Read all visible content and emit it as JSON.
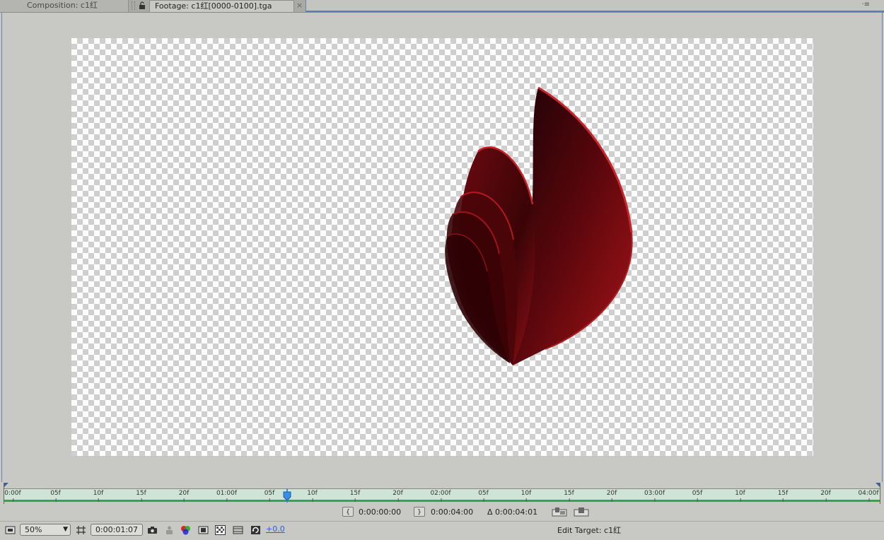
{
  "tabs": {
    "composition_label": "Composition: c1红",
    "footage_label": "Footage: c1红[0000-0100].tga",
    "dropdown_glyph": "▼",
    "close_glyph": "×",
    "panel_menu_glyph": "·≡"
  },
  "ruler": {
    "ticks": [
      {
        "label": "0:00f"
      },
      {
        "label": "05f"
      },
      {
        "label": "10f"
      },
      {
        "label": "15f"
      },
      {
        "label": "20f"
      },
      {
        "label": "01:00f"
      },
      {
        "label": "05f"
      },
      {
        "label": "10f"
      },
      {
        "label": "15f"
      },
      {
        "label": "20f"
      },
      {
        "label": "02:00f"
      },
      {
        "label": "05f"
      },
      {
        "label": "10f"
      },
      {
        "label": "15f"
      },
      {
        "label": "20f"
      },
      {
        "label": "03:00f"
      },
      {
        "label": "05f"
      },
      {
        "label": "10f"
      },
      {
        "label": "15f"
      },
      {
        "label": "20f"
      },
      {
        "label": "04:00f"
      }
    ]
  },
  "range": {
    "in_point": "0:00:00:00",
    "out_point": "0:00:04:00",
    "duration": "Δ 0:00:04:01",
    "in_glyph": "{",
    "out_glyph": "}"
  },
  "toolbar": {
    "zoom": "50%",
    "zoom_dd_glyph": "▼",
    "current_time": "0:00:01:07",
    "exposure": "+0.0",
    "edit_target": "Edit Target: c1红"
  },
  "colors": {
    "accent_blue": "#5a7db3",
    "ruler_band": "#cfe3d6",
    "work_area_green": "#2fa84a",
    "shape_red": "#8e0f14"
  },
  "icons": [
    "lock-icon",
    "snapshot-camera-icon",
    "show-snapshot-icon",
    "channels-icon",
    "region-of-interest-icon",
    "transparency-grid-icon",
    "guides-icon",
    "reset-exposure-icon",
    "overlay-edit-icon",
    "ripple-insert-icon",
    "resolution-icon"
  ]
}
